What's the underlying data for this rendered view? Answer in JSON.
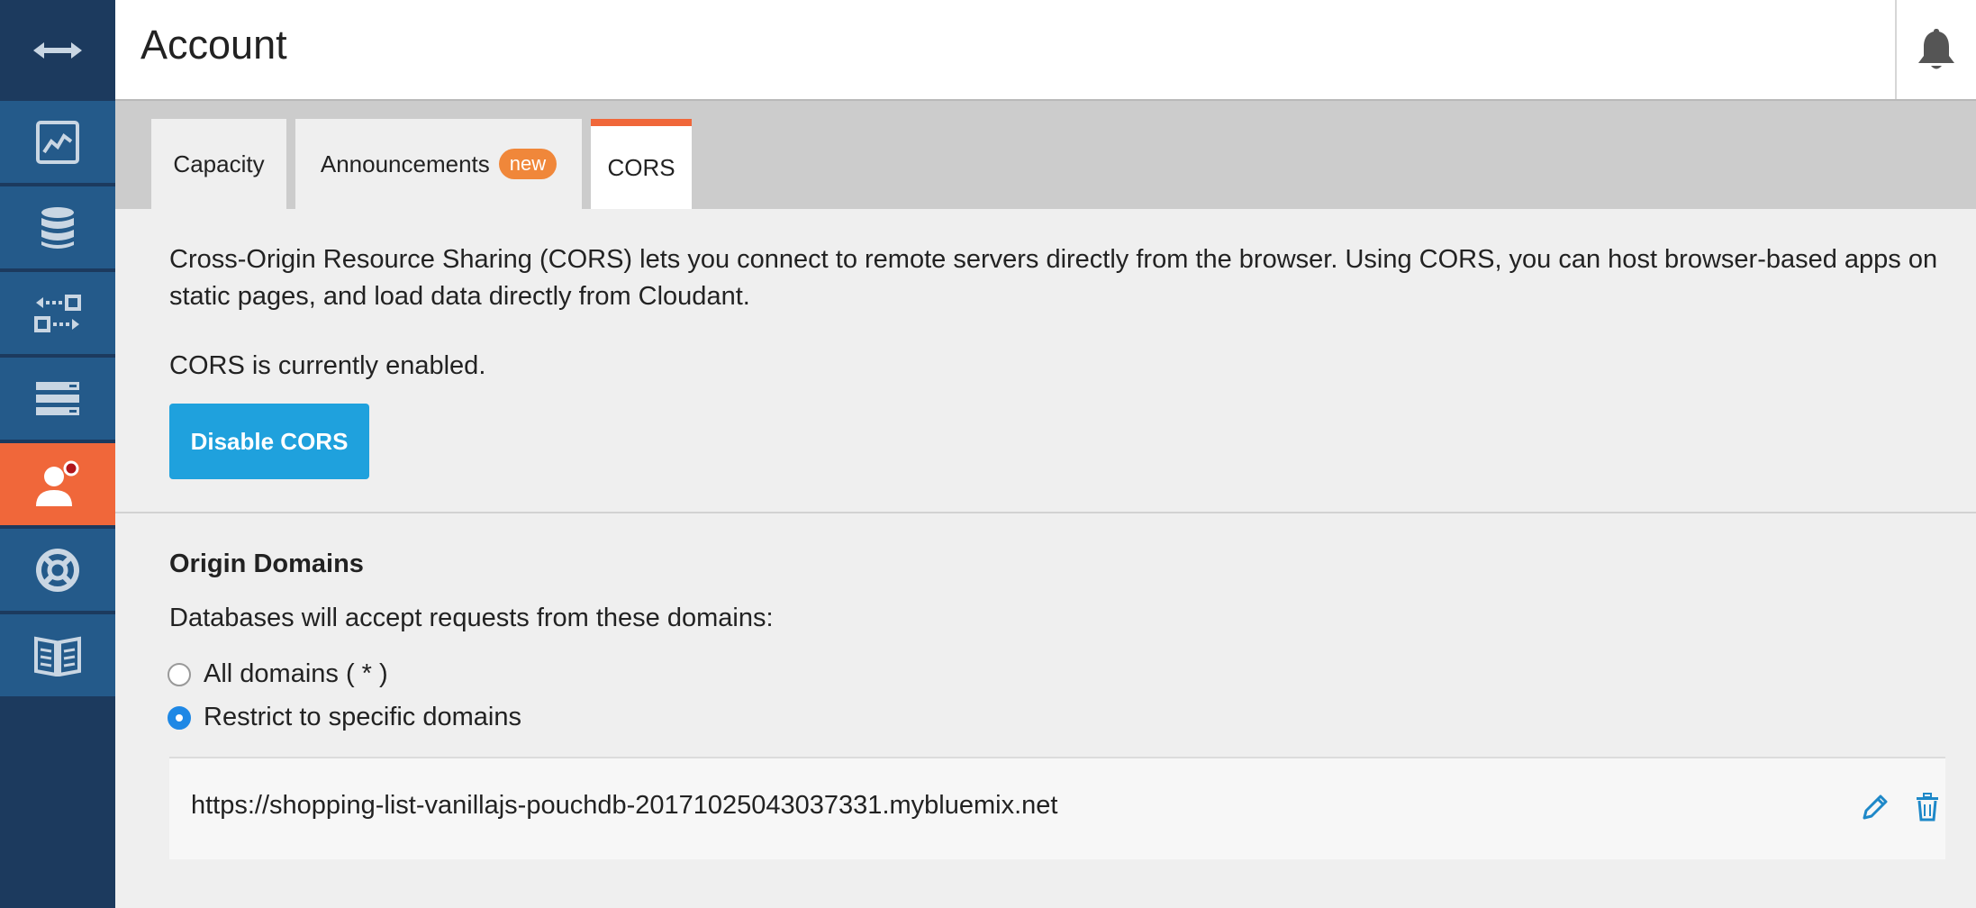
{
  "header": {
    "title": "Account"
  },
  "tabs": [
    {
      "label": "Capacity"
    },
    {
      "label": "Announcements",
      "badge": "new"
    },
    {
      "label": "CORS"
    }
  ],
  "cors": {
    "description": "Cross-Origin Resource Sharing (CORS) lets you connect to remote servers directly from the browser. Using CORS, you can host browser-based apps on static pages, and load data directly from Cloudant.",
    "status": "CORS is currently enabled.",
    "toggle_button": "Disable CORS"
  },
  "origins": {
    "title": "Origin Domains",
    "subtitle": "Databases will accept requests from these domains:",
    "options": [
      {
        "label": "All domains ( * )",
        "selected": false
      },
      {
        "label": "Restrict to specific domains",
        "selected": true
      }
    ],
    "domains": [
      "https://shopping-list-vanillajs-pouchdb-20171025043037331.mybluemix.net"
    ]
  },
  "sidebar": {
    "items": [
      {
        "icon": "activity-chart-icon"
      },
      {
        "icon": "database-icon"
      },
      {
        "icon": "replication-icon"
      },
      {
        "icon": "server-stack-icon"
      },
      {
        "icon": "account-user-icon",
        "active": true
      },
      {
        "icon": "support-lifebuoy-icon"
      },
      {
        "icon": "documentation-book-icon"
      }
    ]
  },
  "colors": {
    "sidebar_bg": "#1c3a5e",
    "sidebar_item": "#245a8a",
    "active_accent": "#f0673a",
    "primary_button": "#1fa1dd",
    "link_icon": "#1e88c8"
  }
}
